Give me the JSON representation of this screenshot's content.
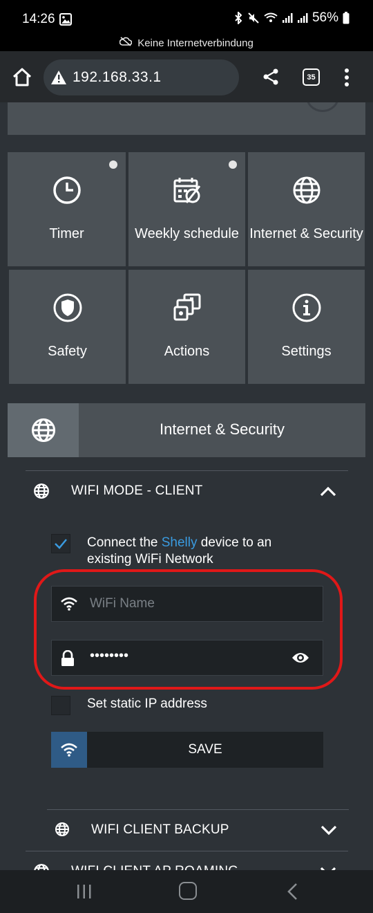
{
  "status_bar": {
    "time": "14:26",
    "battery": "56%"
  },
  "offline_banner": {
    "text": "Keine Internetverbindung"
  },
  "browser": {
    "url": "192.168.33.1",
    "tab_count": "35"
  },
  "tiles": [
    {
      "label": "Timer",
      "icon": "clock-icon",
      "dot": true
    },
    {
      "label": "Weekly schedule",
      "icon": "calendar-icon",
      "dot": true
    },
    {
      "label": "Internet & Security",
      "icon": "globe-icon",
      "dot": false
    },
    {
      "label": "Safety",
      "icon": "shield-icon",
      "dot": false
    },
    {
      "label": "Actions",
      "icon": "actions-icon",
      "dot": false
    },
    {
      "label": "Settings",
      "icon": "info-icon",
      "dot": false
    }
  ],
  "section": {
    "title": "Internet & Security"
  },
  "wifi_client": {
    "title": "WIFI MODE - CLIENT",
    "connect_text_pre": "Connect the ",
    "connect_link": "Shelly",
    "connect_text_post": " device to an existing WiFi Network",
    "connect_checked": true,
    "wifi_name_placeholder": "WiFi Name",
    "password_mask": "••••••••",
    "static_ip_label": "Set static IP address",
    "static_ip_checked": false,
    "save_label": "SAVE"
  },
  "wifi_backup": {
    "title": "WIFI CLIENT BACKUP"
  },
  "wifi_roaming": {
    "title": "WIFI CLIENT AP ROAMING"
  },
  "colors": {
    "accent": "#3a9be0",
    "highlight": "#e01818",
    "tile": "#4b5156",
    "page_bg": "#2d3237"
  }
}
